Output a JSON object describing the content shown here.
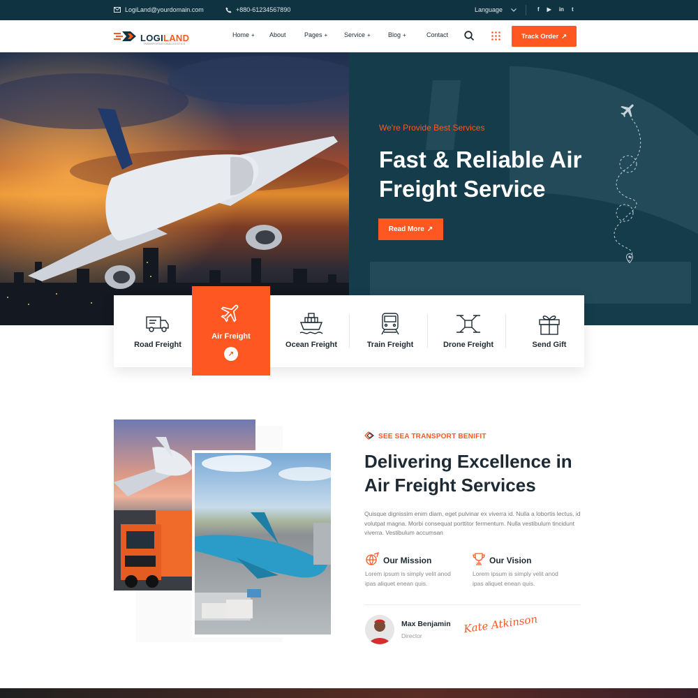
{
  "topbar": {
    "email": "LogiLand@yourdomain.com",
    "phone": "+880-61234567890",
    "language": "Language",
    "social": [
      "f",
      "▶",
      "in",
      "t"
    ]
  },
  "nav": {
    "logo_part1": "LOGI",
    "logo_part2": "LAND",
    "logo_sub": "TRANSPORTATION&LOGISTICS",
    "items": [
      {
        "label": "Home",
        "plus": "+"
      },
      {
        "label": "About",
        "plus": ""
      },
      {
        "label": "Pages",
        "plus": "+"
      },
      {
        "label": "Service",
        "plus": "+"
      },
      {
        "label": "Blog",
        "plus": "+"
      },
      {
        "label": "Contact",
        "plus": ""
      }
    ],
    "track_label": "Track Order",
    "arrow": "↗"
  },
  "hero": {
    "tag": "We're Provide Best Services",
    "title": "Fast & Reliable Air Freight Service",
    "button": "Read More",
    "arrow": "↗"
  },
  "services": [
    {
      "label": "Road Freight",
      "icon": "truck-icon"
    },
    {
      "label": "Air Freight",
      "icon": "airplane-icon",
      "active": true
    },
    {
      "label": "Ocean Freight",
      "icon": "ship-icon"
    },
    {
      "label": "Train Freight",
      "icon": "train-icon"
    },
    {
      "label": "Drone Freight",
      "icon": "drone-icon"
    },
    {
      "label": "Send Gift",
      "icon": "gift-icon"
    }
  ],
  "about": {
    "tagline": "SEE SEA TRANSPORT BENIFIT",
    "title": "Delivering Excellence in Air Freight Services",
    "text": "Quisque dignissim enim diam, eget pulvinar ex viverra id. Nulla a lobortis lectus, id volutpat magna. Morbi consequat porttitor fermentum. Nulla vestibulum tincidunt viverra. Vestibulum accumsan",
    "mission_title": "Our Mission",
    "mission_text": "Lorem ipsum is simply velit anod ipas aliquet enean quis.",
    "vision_title": "Our Vision",
    "vision_text": "Lorem ipsum is simply velit anod ipas aliquet enean quis.",
    "person_name": "Max Benjamin",
    "person_role": "Director",
    "signature": "Kate Atkinson"
  },
  "colors": {
    "accent": "#ff5722",
    "dark": "#0f3340",
    "hero_dark": "#143c4a"
  }
}
